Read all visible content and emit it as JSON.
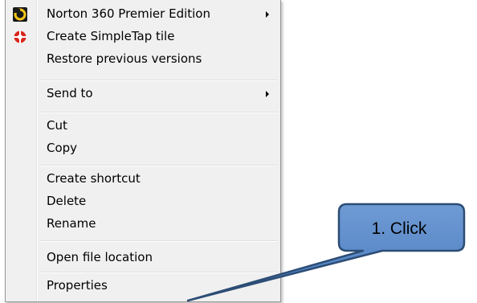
{
  "menu": {
    "items": [
      {
        "label": "Norton 360 Premier Edition",
        "icon": "norton-icon",
        "submenu": true
      },
      {
        "label": "Create SimpleTap tile",
        "icon": "simpletap-icon",
        "submenu": false
      },
      {
        "label": "Restore previous versions",
        "icon": "",
        "submenu": false
      },
      {
        "label": "Send to",
        "icon": "",
        "submenu": true
      },
      {
        "label": "Cut",
        "icon": "",
        "submenu": false
      },
      {
        "label": "Copy",
        "icon": "",
        "submenu": false
      },
      {
        "label": "Create shortcut",
        "icon": "",
        "submenu": false
      },
      {
        "label": "Delete",
        "icon": "",
        "submenu": false
      },
      {
        "label": "Rename",
        "icon": "",
        "submenu": false
      },
      {
        "label": "Open file location",
        "icon": "",
        "submenu": false
      },
      {
        "label": "Properties",
        "icon": "",
        "submenu": false
      }
    ]
  },
  "callout": {
    "text": "1. Click",
    "fill_color": "#4f81bd",
    "border_color": "#2c4d75"
  },
  "colors": {
    "menu_background": "#f0f0f0",
    "menu_border": "#979797",
    "norton_yellow": "#f5c518",
    "simpletap_red": "#d9271e"
  }
}
